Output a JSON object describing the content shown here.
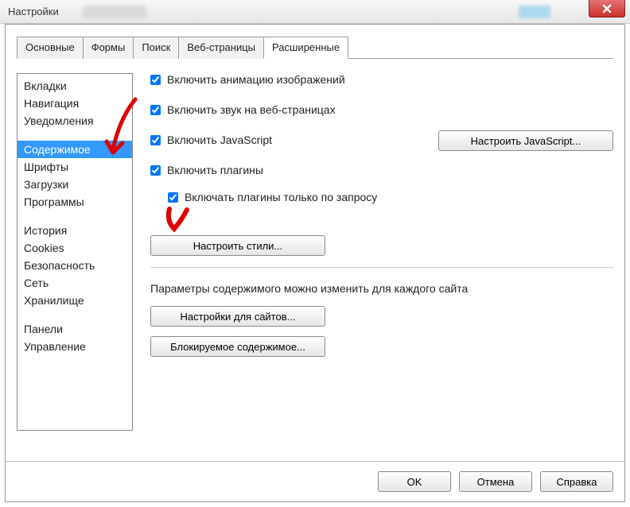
{
  "window": {
    "title": "Настройки"
  },
  "tabs": [
    "Основные",
    "Формы",
    "Поиск",
    "Веб-страницы",
    "Расширенные"
  ],
  "active_tab_index": 4,
  "sidebar": {
    "groups": [
      [
        "Вкладки",
        "Навигация",
        "Уведомления"
      ],
      [
        "Содержимое",
        "Шрифты",
        "Загрузки",
        "Программы"
      ],
      [
        "История",
        "Cookies",
        "Безопасность",
        "Сеть",
        "Хранилище"
      ],
      [
        "Панели",
        "Управление"
      ]
    ],
    "selected": "Содержимое"
  },
  "checks": {
    "anim": {
      "label": "Включить анимацию изображений",
      "checked": true
    },
    "sound": {
      "label": "Включить звук на веб-страницах",
      "checked": true
    },
    "js": {
      "label": "Включить JavaScript",
      "checked": true
    },
    "plugins": {
      "label": "Включить плагины",
      "checked": true
    },
    "plugins_on_demand": {
      "label": "Включать плагины только по запросу",
      "checked": true
    }
  },
  "buttons": {
    "js_settings": "Настроить JavaScript...",
    "styles": "Настроить стили...",
    "site_settings": "Настройки для сайтов...",
    "blocked": "Блокируемое содержимое..."
  },
  "para": "Параметры содержимого можно изменить для каждого сайта",
  "footer": {
    "ok": "OK",
    "cancel": "Отмена",
    "help": "Справка"
  }
}
